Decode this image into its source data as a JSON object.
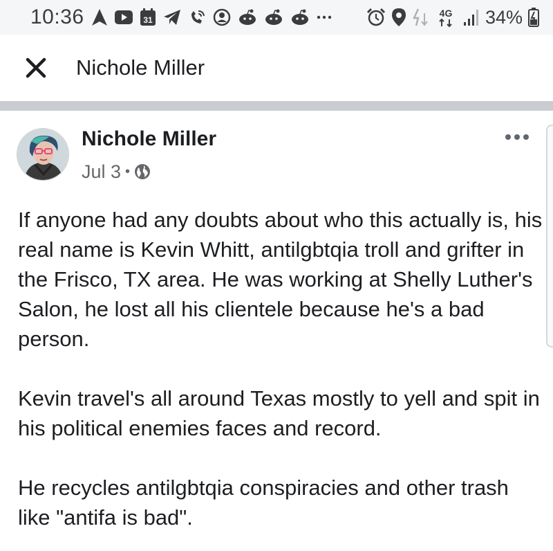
{
  "status_bar": {
    "time": "10:36",
    "calendar_day": "31",
    "network": "4G",
    "battery": "34%",
    "icons": [
      "navigation-icon",
      "youtube-icon",
      "calendar-icon",
      "telegram-icon",
      "wifi-call-icon",
      "account-icon",
      "reddit-icon",
      "reddit-icon",
      "reddit-icon",
      "more-notifications-icon",
      "alarm-icon",
      "location-icon",
      "data-transfer-icon",
      "signal-icon",
      "battery-charging-icon"
    ]
  },
  "header": {
    "title": "Nichole Miller",
    "close_icon": "close-icon"
  },
  "post": {
    "author": "Nichole Miller",
    "date": "Jul 3",
    "separator": "•",
    "privacy_icon": "globe-icon",
    "paragraphs": [
      "If anyone had any doubts about who this actually is, his real name is Kevin Whitt, antilgbtqia troll and grifter in the Frisco, TX area. He was working at Shelly Luther's Salon, he lost all his clientele because he's a bad person.",
      "Kevin travel's all around Texas mostly to yell and spit in his political enemies faces and record.",
      "He recycles antilgbtqia conspiracies and other trash like \"antifa is bad\"."
    ]
  },
  "colors": {
    "text": "#1c1e21",
    "secondary": "#65676b",
    "divider": "#c9ccd1",
    "status_bar_bg": "#f5f6f8"
  }
}
